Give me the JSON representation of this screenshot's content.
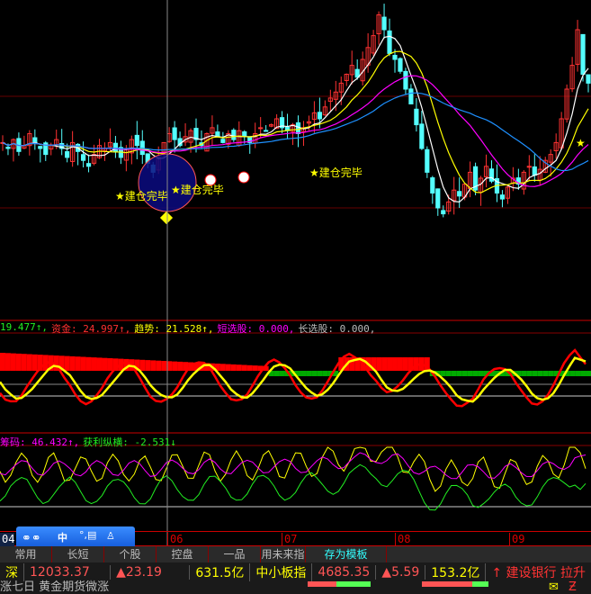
{
  "main_panel": {
    "closes": [
      52,
      50,
      53,
      49,
      51,
      55,
      52,
      50,
      48,
      51,
      53,
      50,
      47,
      52,
      49,
      46,
      44,
      48,
      51,
      50,
      52,
      49,
      47,
      50,
      53,
      51,
      48,
      45,
      42,
      47,
      52,
      55,
      53,
      51,
      54,
      56,
      53,
      51,
      55,
      57,
      54,
      52,
      55,
      53,
      56,
      54,
      52,
      55,
      57,
      56,
      58,
      60,
      57,
      56,
      58,
      55,
      57,
      59,
      62,
      60,
      64,
      67,
      69,
      72,
      75,
      78,
      74,
      80,
      84,
      88,
      95,
      90,
      82,
      80,
      76,
      70,
      65,
      58,
      50,
      42,
      35,
      30,
      28,
      32,
      36,
      34,
      38,
      42,
      36,
      40,
      44,
      39,
      35,
      33,
      37,
      40,
      38,
      42,
      44,
      41,
      43,
      46,
      48,
      52,
      60,
      70,
      78,
      90,
      75,
      72
    ],
    "annotations": [
      {
        "label": "★建仓完毕"
      },
      {
        "label": "★建仓完毕"
      },
      {
        "label": "★建仓完毕"
      },
      {
        "label": "★"
      }
    ],
    "colors": {
      "up": "#ff3232",
      "down": "#54ffff",
      "ma1": "#ffffff",
      "ma2": "#ffff00",
      "ma3": "#ff00ff",
      "ma4": "#1e90ff"
    }
  },
  "indicator1": {
    "items": [
      {
        "text": "19.477↑,",
        "color": "#22ee22"
      },
      {
        "text": "资金: 24.997↑,",
        "color": "#ff3030"
      },
      {
        "text": "趋势: 21.528↑,",
        "color": "#ffff00"
      },
      {
        "text": "短选股: 0.000,",
        "color": "#ff00ff"
      },
      {
        "text": "长选股: 0.000,",
        "color": "#bbbbbb"
      }
    ]
  },
  "indicator2": {
    "items": [
      {
        "text": "筹码: 46.432↑,",
        "color": "#ff00ff"
      },
      {
        "text": "获利纵横: -2.531↓",
        "color": "#22ee22"
      }
    ]
  },
  "date_axis": {
    "start": "04",
    "labels": [
      "06",
      "07",
      "08",
      "09"
    ]
  },
  "tabs": [
    "常用",
    "长短",
    "个股",
    "控盘",
    "一品",
    "用未来指标",
    "存为模板"
  ],
  "ticker": {
    "market1": "深",
    "value1": "12033.37",
    "change1": "▲23.19",
    "volume1": "631.5亿",
    "market2": "中小板指",
    "value2": "4685.35",
    "change2": "▲5.59",
    "volume2": "153.2亿",
    "news": "↑ 建设银行 拉升"
  },
  "bottom_news": "涨七日 黄金期货微涨",
  "olympic_bar": {
    "label": "中"
  }
}
